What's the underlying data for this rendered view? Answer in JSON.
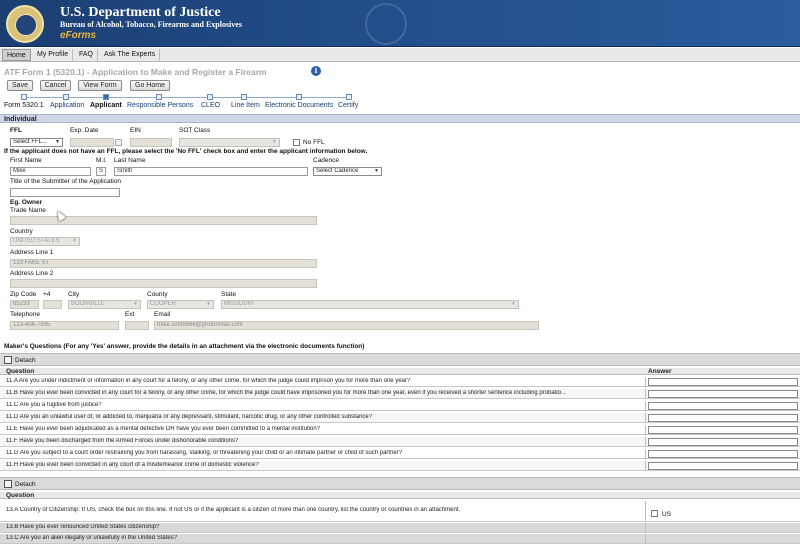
{
  "header": {
    "title": "U.S. Department of Justice",
    "subtitle": "Bureau of Alcohol, Tobacco, Firearms and Explosives",
    "product": "eForms"
  },
  "nav": {
    "tabs": [
      "Home",
      "My Profile",
      "FAQ",
      "Ask The Experts"
    ]
  },
  "page_title": "ATF Form 1 (5320.1) - Application to Make and Register a Firearm",
  "toolbar": {
    "save": "Save",
    "cancel": "Cancel",
    "view_form": "View Form",
    "go_home": "Go Home"
  },
  "steps": [
    "Form 5320.1",
    "Application",
    "Applicant",
    "Responsible Persons",
    "CLEO",
    "Line Item",
    "Electronic Documents",
    "Certify"
  ],
  "section_individual": "Individual",
  "ffl": {
    "ffl_label": "FFL",
    "ffl_value": "Select FFL...",
    "exp_label": "Exp. Date",
    "ein_label": "EIN",
    "sot_label": "SOT Class",
    "no_ffl": "No FFL",
    "instruction": "If the applicant does not have an FFL, please select the 'No FFL' check box and enter the applicant information below."
  },
  "person": {
    "first_label": "First Name",
    "first_value": "Mike",
    "mi_label": "M.I.",
    "mi_value": "S",
    "last_label": "Last Name",
    "last_value": "Smith",
    "cadence_label": "Cadence",
    "cadence_value": "Select Cadence",
    "submitter_label": "Title of the Submitter of the Application",
    "submitter_value": "",
    "eg_owner": "Eg. Owner",
    "trade_label": "Trade Name",
    "trade_value": "",
    "country_label": "Country",
    "country_value": "UNITED STATES",
    "addr1_label": "Address Line 1",
    "addr1_value": "123 FAKE ST",
    "addr2_label": "Address Line 2",
    "addr2_value": "",
    "zip_label": "Zip Code",
    "zip_value": "65233",
    "plus4_label": "+4",
    "city_label": "City",
    "city_value": "BOONVILLE",
    "county_label": "County",
    "county_value": "COOPER",
    "state_label": "State",
    "state_value": "MISSOURI",
    "phone_label": "Telephone",
    "phone_value": "123-456-7895",
    "ext_label": "Ext",
    "email_label": "Email",
    "email_value": "mike.smith666@protonmail.com"
  },
  "makers": {
    "heading": "Maker's Questions (For any 'Yes' answer, provide the details in an attachment via the electronic documents function)",
    "detach": "Detach",
    "question_header": "Question",
    "answer_header": "Answer",
    "questions": [
      "11.A Are you under indictment or information in any court for a felony, or any other crime, for which the judge could imprison you for more than one year?",
      "11.B Have you ever been convicted in any court for a felony, or any other crime, for which the judge could have imprisoned you for more than one year, even if you received a shorter sentence including probatio...",
      "11.C Are you a fugitive from justice?",
      "11.D Are you an unlawful user of, or addicted to, marijuana or any depressant, stimulant, narcotic drug, or any other controlled substance?",
      "11.E Have you ever been adjudicated as a mental defective OR have you ever been committed to a mental institution?",
      "11.F Have you been discharged from the Armed Forces under dishonorable conditions?",
      "11.G Are you subject to a court order restraining you from harassing, stalking, or threatening your child or an intimate partner or child of such partner?",
      "11.H Have you ever been convicted in any court of a misdemeanor crime of domestic violence?"
    ]
  },
  "citizenship": {
    "detach": "Detach",
    "question_header": "Question",
    "questions": [
      "13.A Country of Citizenship: If US, check the box on this line. If not US or if the applicant is a citizen of more than one country, list the country or countries in an attachment.",
      "13.B Have you ever renounced United States citizenship?",
      "13.C Are you an alien illegally or unlawfully in the United States?"
    ],
    "us_label": "US"
  }
}
